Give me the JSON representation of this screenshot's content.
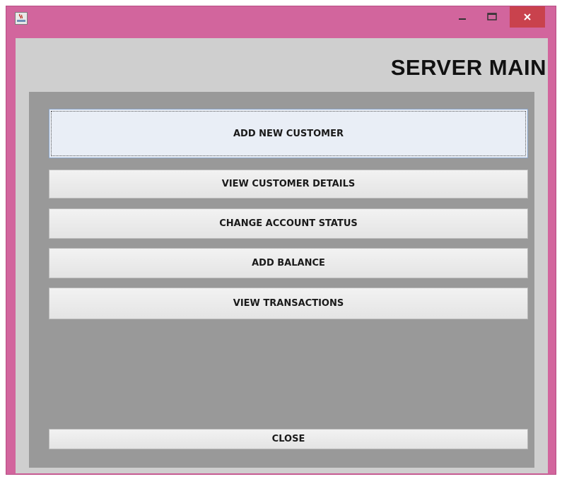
{
  "window": {
    "title": "",
    "controls": {
      "minimize": "minimize",
      "maximize": "maximize",
      "close": "close"
    }
  },
  "header": {
    "title": "SERVER MAIN"
  },
  "buttons": {
    "add_new_customer": "ADD NEW CUSTOMER",
    "view_customer_details": "VIEW CUSTOMER DETAILS",
    "change_account_status": "CHANGE ACCOUNT STATUS",
    "add_balance": "ADD BALANCE",
    "view_transactions": "VIEW TRANSACTIONS",
    "close": "CLOSE"
  },
  "colors": {
    "window_frame": "#d2659d",
    "client_bg": "#cfcfcf",
    "panel_bg": "#999999",
    "close_control": "#c9424d"
  },
  "icons": {
    "app": "java-app-icon",
    "minimize": "minimize-icon",
    "maximize": "maximize-icon",
    "close": "close-icon"
  }
}
